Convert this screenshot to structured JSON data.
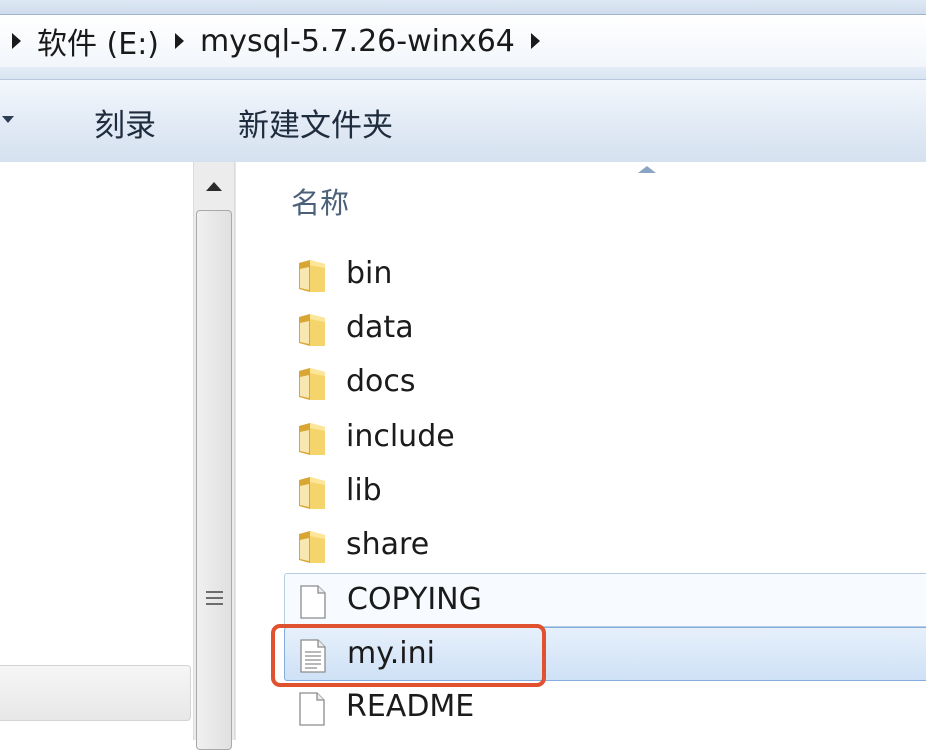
{
  "address_bar": {
    "crumbs": [
      "软件 (E:)",
      "mysql-5.7.26-winx64"
    ]
  },
  "toolbar": {
    "burn_label": "刻录",
    "new_folder_label": "新建文件夹"
  },
  "file_list": {
    "column_header": "名称",
    "items": [
      {
        "name": "bin",
        "type": "folder"
      },
      {
        "name": "data",
        "type": "folder"
      },
      {
        "name": "docs",
        "type": "folder"
      },
      {
        "name": "include",
        "type": "folder"
      },
      {
        "name": "lib",
        "type": "folder"
      },
      {
        "name": "share",
        "type": "folder"
      },
      {
        "name": "COPYING",
        "type": "file"
      },
      {
        "name": "my.ini",
        "type": "file"
      },
      {
        "name": "README",
        "type": "file"
      }
    ],
    "hovered": "COPYING",
    "selected": "my.ini"
  },
  "colors": {
    "highlight_border": "#e0512f",
    "selection_fill": "#cfe1f6",
    "folder_yellow": "#f2c94c"
  },
  "icons": {
    "folder": "folder-icon",
    "file": "document-icon"
  }
}
